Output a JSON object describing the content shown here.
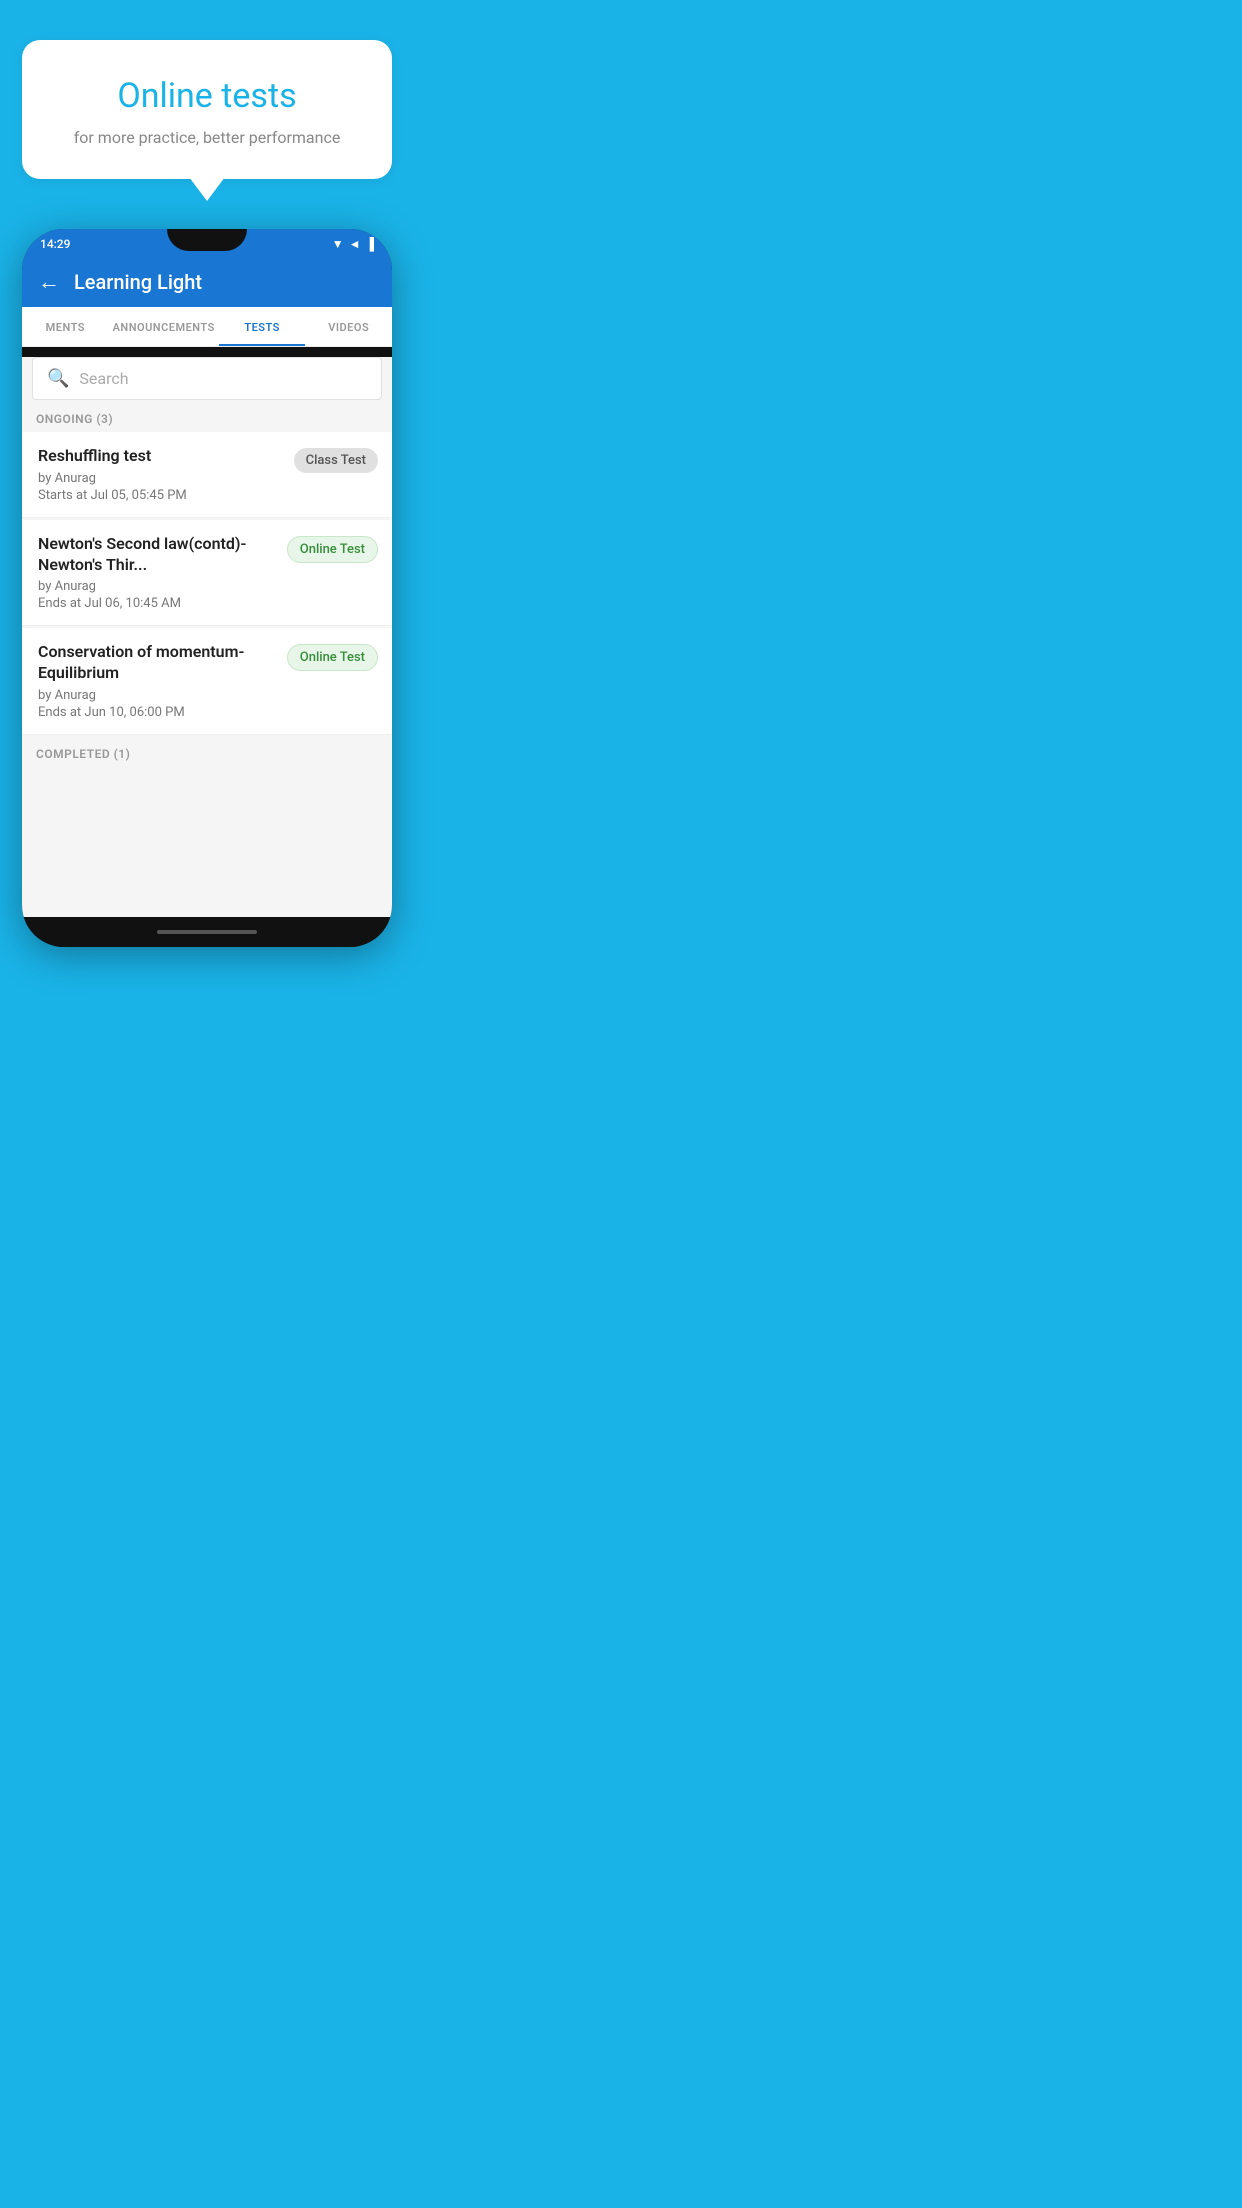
{
  "background_color": "#1ab3e8",
  "bubble": {
    "title": "Online tests",
    "subtitle": "for more practice, better performance"
  },
  "phone": {
    "status_bar": {
      "time": "14:29",
      "icons": "▼◄▐"
    },
    "app_bar": {
      "title": "Learning Light",
      "back_label": "←"
    },
    "tabs": [
      {
        "label": "MENTS",
        "active": false
      },
      {
        "label": "ANNOUNCEMENTS",
        "active": false
      },
      {
        "label": "TESTS",
        "active": true
      },
      {
        "label": "VIDEOS",
        "active": false
      }
    ],
    "search": {
      "placeholder": "Search",
      "icon": "🔍"
    },
    "ongoing_section": {
      "header": "ONGOING (3)",
      "tests": [
        {
          "title": "Reshuffling test",
          "author": "by Anurag",
          "time_label": "Starts at",
          "time": "Jul 05, 05:45 PM",
          "badge": "Class Test",
          "badge_type": "class"
        },
        {
          "title": "Newton's Second law(contd)-Newton's Thir...",
          "author": "by Anurag",
          "time_label": "Ends at",
          "time": "Jul 06, 10:45 AM",
          "badge": "Online Test",
          "badge_type": "online"
        },
        {
          "title": "Conservation of momentum-Equilibrium",
          "author": "by Anurag",
          "time_label": "Ends at",
          "time": "Jun 10, 06:00 PM",
          "badge": "Online Test",
          "badge_type": "online"
        }
      ]
    },
    "completed_section": {
      "header": "COMPLETED (1)"
    }
  }
}
